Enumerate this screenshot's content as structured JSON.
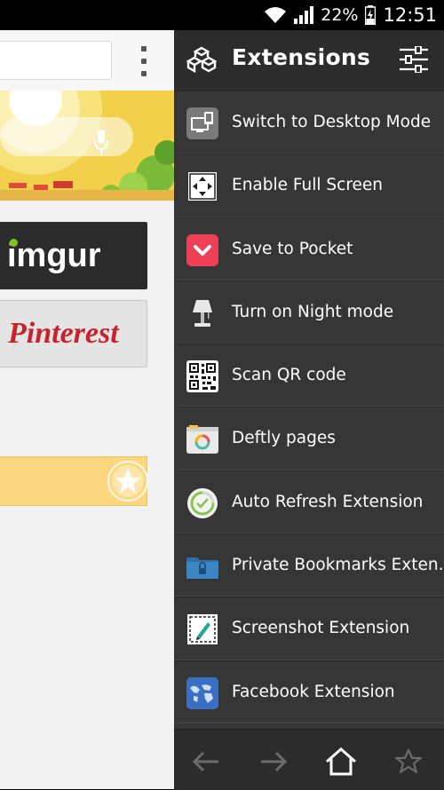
{
  "status_bar": {
    "battery": "22%",
    "time": "12:51",
    "icons": [
      "wifi-icon",
      "signal-icon",
      "battery-charging-icon"
    ]
  },
  "browser": {
    "tiles": [
      {
        "label": "imgur",
        "accent": "#85bf25"
      },
      {
        "label": "Pinterest",
        "color": "#c8232c"
      }
    ]
  },
  "extensions_panel": {
    "title": "Extensions",
    "items": [
      {
        "label": "Switch to Desktop Mode",
        "icon": "desktop-mode-icon"
      },
      {
        "label": "Enable Full Screen",
        "icon": "fullscreen-icon"
      },
      {
        "label": "Save to Pocket",
        "icon": "pocket-icon"
      },
      {
        "label": "Turn on Night mode",
        "icon": "lamp-icon"
      },
      {
        "label": "Scan QR code",
        "icon": "qr-code-icon"
      },
      {
        "label": "Deftly pages",
        "icon": "deftly-icon"
      },
      {
        "label": "Auto Refresh Extension",
        "icon": "auto-refresh-icon"
      },
      {
        "label": "Private Bookmarks Exten.",
        "icon": "private-bookmarks-icon"
      },
      {
        "label": "Screenshot Extension",
        "icon": "screenshot-icon"
      },
      {
        "label": "Facebook Extension",
        "icon": "facebook-globe-icon"
      }
    ],
    "bottom_nav": [
      "back-arrow-icon",
      "forward-arrow-icon",
      "home-icon",
      "star-icon"
    ]
  },
  "colors": {
    "panel_bg": "#363636",
    "header_bg": "#2c2c2c",
    "pocket_red": "#ee4056",
    "fav_bar": "#fcd77f"
  }
}
